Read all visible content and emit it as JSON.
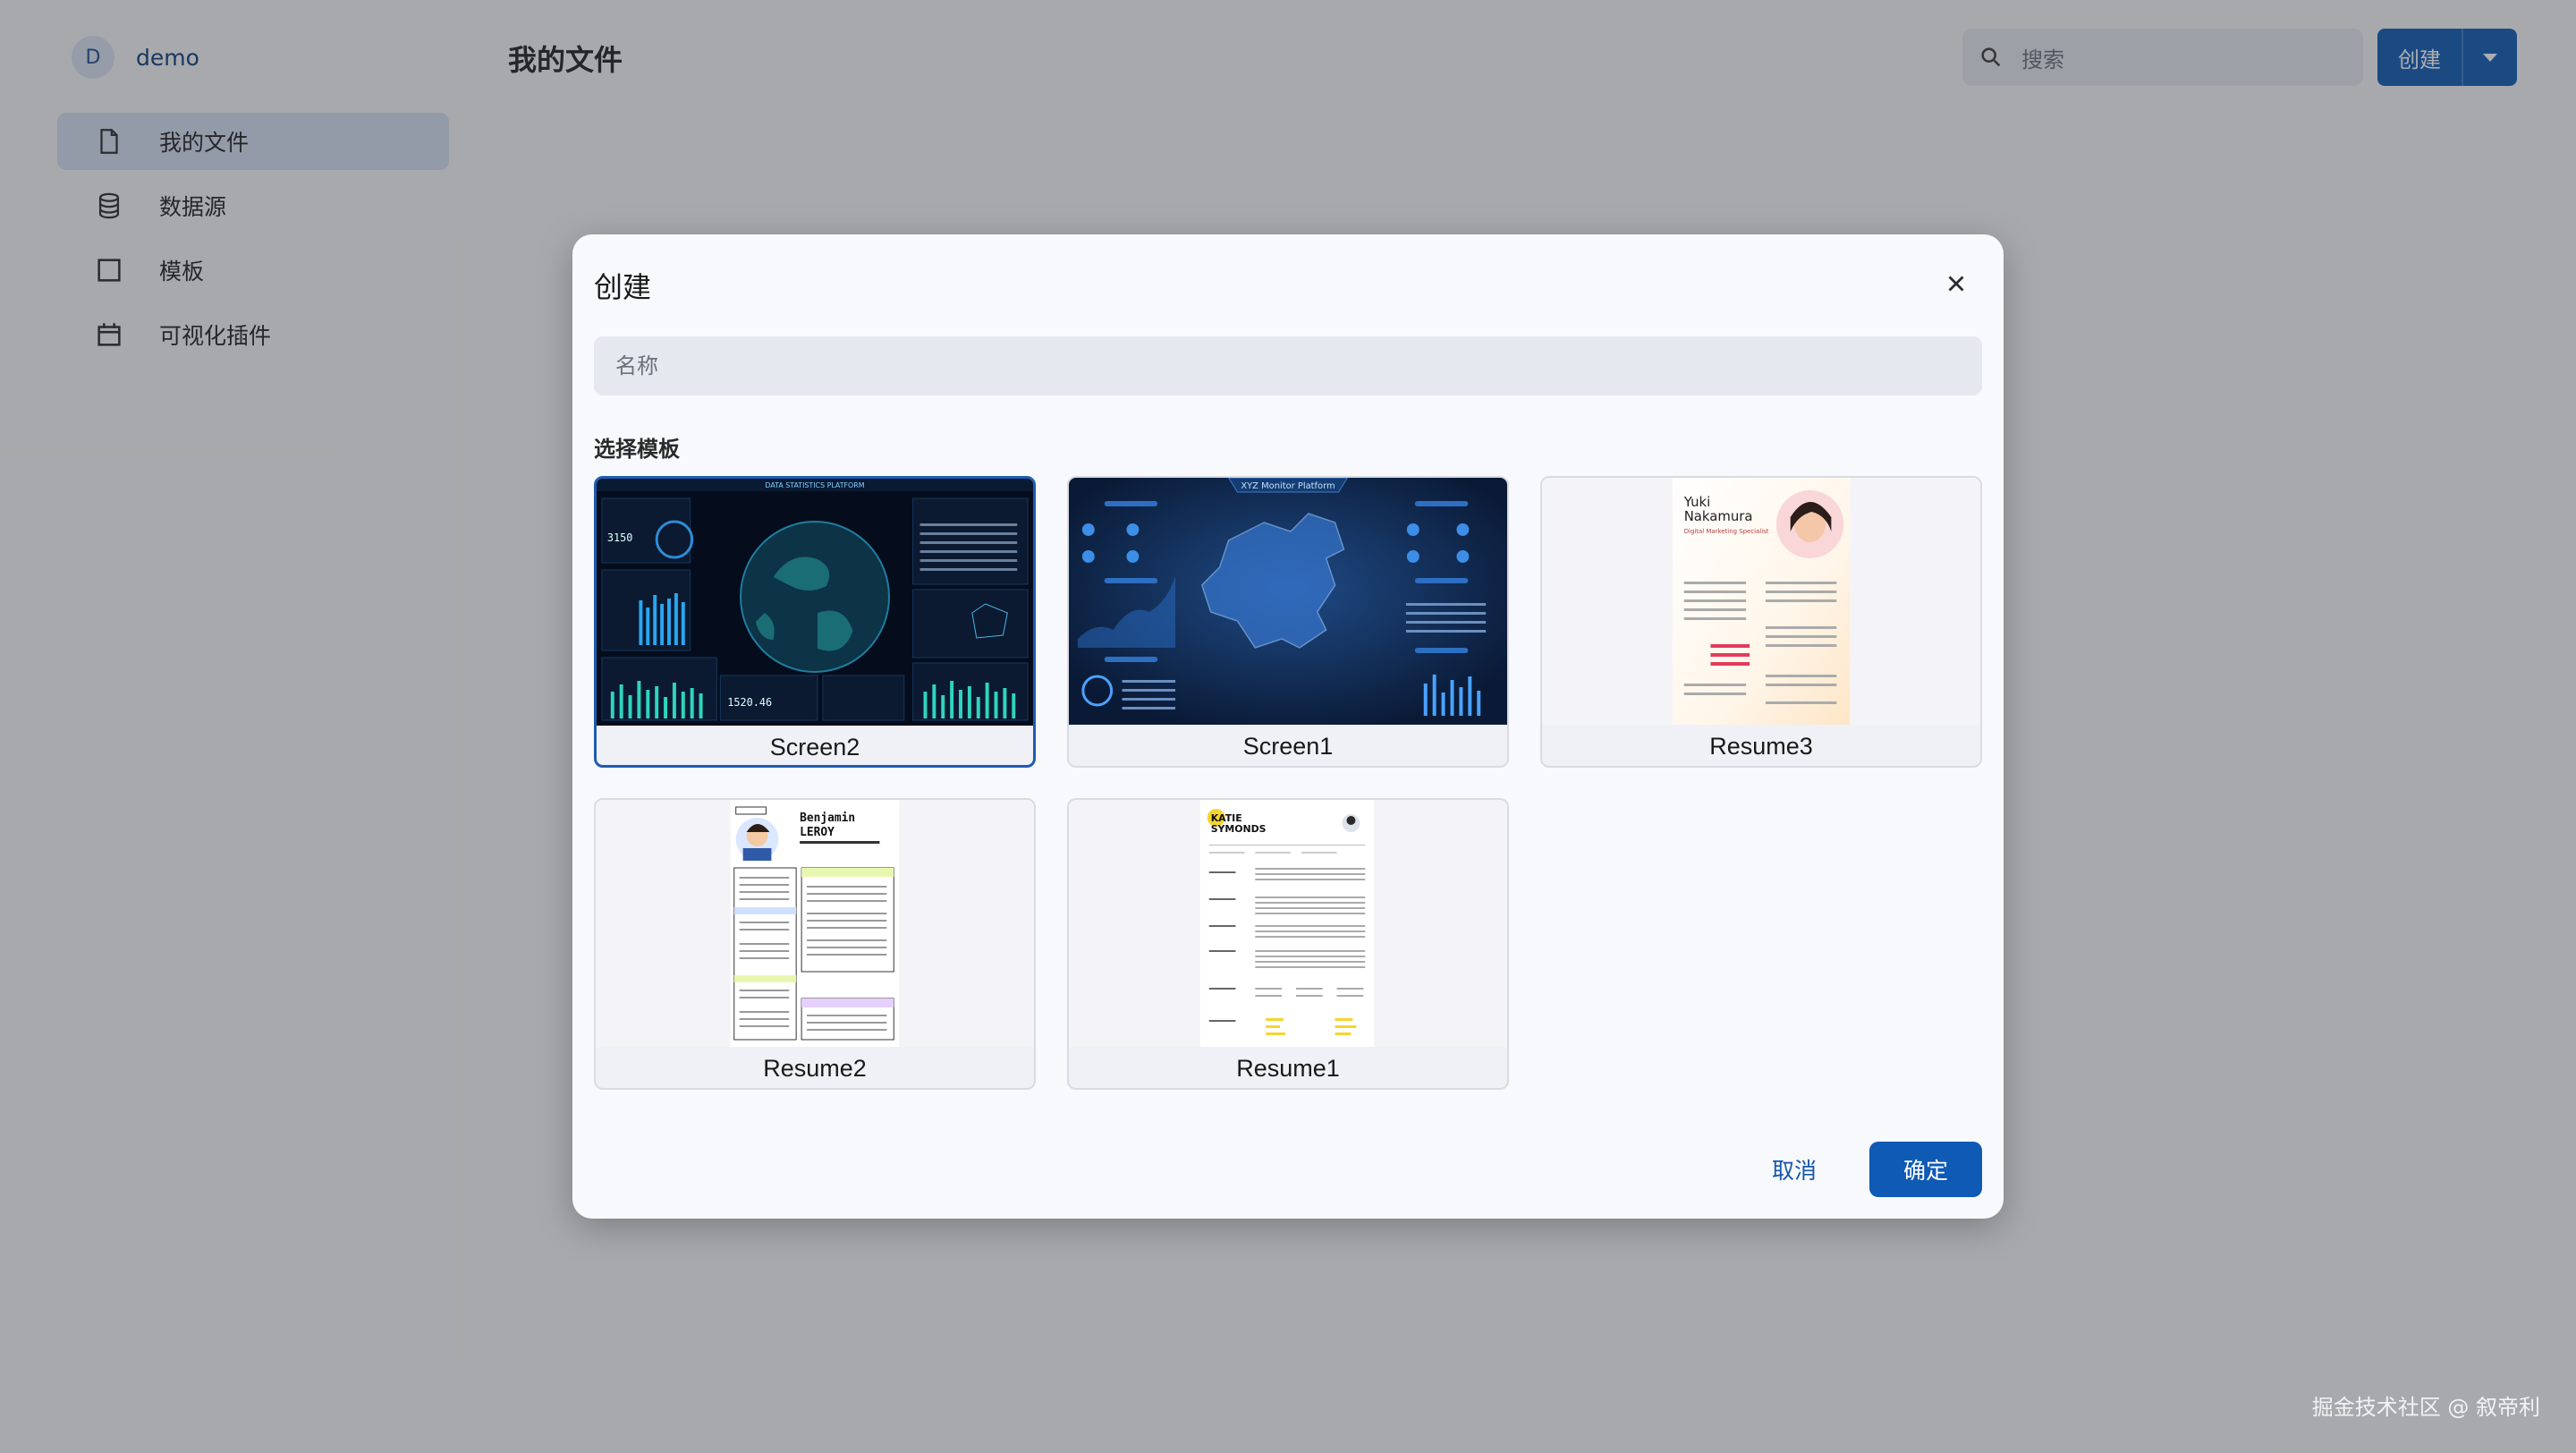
{
  "app": {
    "avatar_letter": "D",
    "user_name": "demo"
  },
  "sidebar": {
    "items": [
      {
        "label": "我的文件",
        "icon": "file-icon",
        "active": true
      },
      {
        "label": "数据源",
        "icon": "database-icon",
        "active": false
      },
      {
        "label": "模板",
        "icon": "template-icon",
        "active": false
      },
      {
        "label": "可视化插件",
        "icon": "plugin-icon",
        "active": false
      }
    ]
  },
  "header": {
    "title": "我的文件",
    "search_placeholder": "搜索",
    "create_label": "创建"
  },
  "dialog": {
    "title": "创建",
    "name_placeholder": "名称",
    "section_label": "选择模板",
    "templates": [
      {
        "label": "Screen2",
        "selected": true
      },
      {
        "label": "Screen1",
        "selected": false
      },
      {
        "label": "Resume3",
        "selected": false
      },
      {
        "label": "Resume2",
        "selected": false
      },
      {
        "label": "Resume1",
        "selected": false
      }
    ],
    "thumb_text": {
      "screen2_header": "DATA STATISTICS PLATFORM",
      "screen2_num1": "3150",
      "screen2_num2": "1520.46",
      "screen1_header": "XYZ Monitor Platform",
      "resume3_name_1": "Yuki",
      "resume3_name_2": "Nakamura",
      "resume3_role": "Digital Marketing Specialist",
      "resume2_name_1": "Benjamin",
      "resume2_name_2": "LEROY",
      "resume1_name_1": "KATIE",
      "resume1_name_2": "SYMONDS"
    },
    "cancel_label": "取消",
    "ok_label": "确定"
  },
  "watermark": "掘金技术社区 @ 叙帝利",
  "colors": {
    "accent": "#0e5ab5",
    "overlay": "#30323a"
  }
}
